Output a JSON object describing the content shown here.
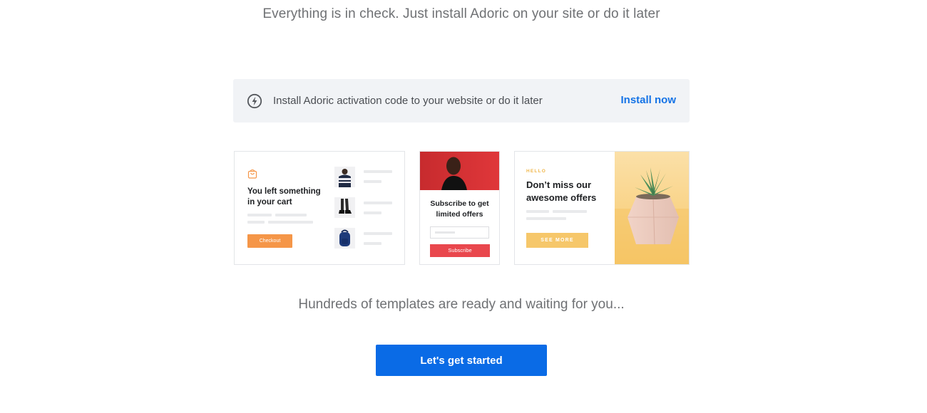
{
  "headline": "Everything is in check. Just install Adoric on your site or do it later",
  "install_bar": {
    "text": "Install Adoric activation code to your website or do it later",
    "link_label": "Install now",
    "icon": "bolt-icon"
  },
  "templates": {
    "cart": {
      "icon": "shopping-bag-icon",
      "title": "You left something in your cart",
      "button_label": "Checkout"
    },
    "subscribe": {
      "title": "Subscribe to get limited offers",
      "button_label": "Subscribe"
    },
    "offers": {
      "eyebrow": "HELLO",
      "title": "Don’t miss our awesome offers",
      "button_label": "SEE MORE"
    }
  },
  "subline": "Hundreds of templates are ready and waiting for you...",
  "cta_label": "Let's get started",
  "colors": {
    "accent": "#0a6be6",
    "link": "#1573e6",
    "checkout": "#f59648",
    "subscribe": "#e9474d",
    "see_more": "#f6c76a"
  }
}
